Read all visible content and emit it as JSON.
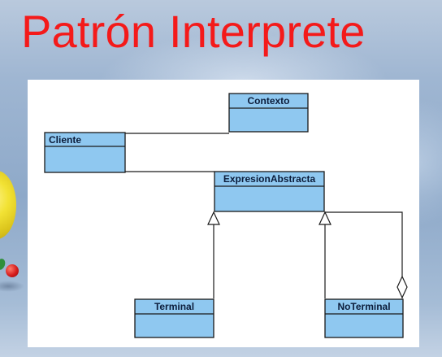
{
  "slide": {
    "title": "Patrón Interprete"
  },
  "diagram": {
    "classes": {
      "contexto": "Contexto",
      "cliente": "Cliente",
      "expresion_abstracta": "ExpresionAbstracta",
      "terminal": "Terminal",
      "no_terminal": "NoTerminal"
    }
  },
  "colors": {
    "title": "#f41a1a",
    "class_fill": "#8fc8f0",
    "panel": "#ffffff",
    "line": "#1a1a1a"
  }
}
